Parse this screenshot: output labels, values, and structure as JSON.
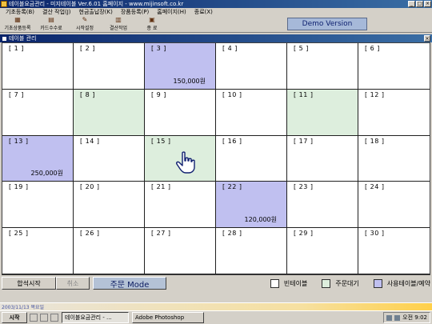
{
  "window": {
    "title": "테이블요금관리 - 미지테이블 Ver.6.01 홈페이지 - www.mijinsoft.co.kr",
    "minimize": "_",
    "maximize": "□",
    "close": "×"
  },
  "menu": [
    "기초등록(B)",
    "결산 작업(J)",
    "현금출납장(K)",
    "장품등록(P)",
    "홈페이지(H)",
    "종료(X)"
  ],
  "toolbar": [
    {
      "label": "기초상품등록",
      "icon": "box-icon"
    },
    {
      "label": "카드수수료",
      "icon": "card-icon"
    },
    {
      "label": "시작설정",
      "icon": "tools-icon"
    },
    {
      "label": "결산작업",
      "icon": "calc-icon"
    },
    {
      "label": "종 료",
      "icon": "exit-icon"
    }
  ],
  "demo_label": "Demo Version",
  "inner_window": {
    "title": "테이블 관리",
    "close": "×"
  },
  "tables": [
    {
      "num": "[ 1 ]",
      "status": "empty",
      "amount": ""
    },
    {
      "num": "[ 2 ]",
      "status": "empty",
      "amount": ""
    },
    {
      "num": "[ 3 ]",
      "status": "use",
      "amount": "150,000원"
    },
    {
      "num": "[ 4 ]",
      "status": "empty",
      "amount": ""
    },
    {
      "num": "[ 5 ]",
      "status": "empty",
      "amount": ""
    },
    {
      "num": "[ 6 ]",
      "status": "empty",
      "amount": ""
    },
    {
      "num": "[ 7 ]",
      "status": "empty",
      "amount": ""
    },
    {
      "num": "[ 8 ]",
      "status": "order",
      "amount": ""
    },
    {
      "num": "[ 9 ]",
      "status": "empty",
      "amount": ""
    },
    {
      "num": "[ 10 ]",
      "status": "empty",
      "amount": ""
    },
    {
      "num": "[ 11 ]",
      "status": "order",
      "amount": ""
    },
    {
      "num": "[ 12 ]",
      "status": "empty",
      "amount": ""
    },
    {
      "num": "[ 13 ]",
      "status": "use",
      "amount": "250,000원"
    },
    {
      "num": "[ 14 ]",
      "status": "empty",
      "amount": ""
    },
    {
      "num": "[ 15 ]",
      "status": "order",
      "amount": ""
    },
    {
      "num": "[ 16 ]",
      "status": "empty",
      "amount": ""
    },
    {
      "num": "[ 17 ]",
      "status": "empty",
      "amount": ""
    },
    {
      "num": "[ 18 ]",
      "status": "empty",
      "amount": ""
    },
    {
      "num": "[ 19 ]",
      "status": "empty",
      "amount": ""
    },
    {
      "num": "[ 20 ]",
      "status": "empty",
      "amount": ""
    },
    {
      "num": "[ 21 ]",
      "status": "empty",
      "amount": ""
    },
    {
      "num": "[ 22 ]",
      "status": "use",
      "amount": "120,000원"
    },
    {
      "num": "[ 23 ]",
      "status": "empty",
      "amount": ""
    },
    {
      "num": "[ 24 ]",
      "status": "empty",
      "amount": ""
    },
    {
      "num": "[ 25 ]",
      "status": "empty",
      "amount": ""
    },
    {
      "num": "[ 26 ]",
      "status": "empty",
      "amount": ""
    },
    {
      "num": "[ 27 ]",
      "status": "empty",
      "amount": ""
    },
    {
      "num": "[ 28 ]",
      "status": "empty",
      "amount": ""
    },
    {
      "num": "[ 29 ]",
      "status": "empty",
      "amount": ""
    },
    {
      "num": "[ 30 ]",
      "status": "empty",
      "amount": ""
    }
  ],
  "controls": {
    "start": "합석시작",
    "cancel": "취소",
    "mode": "주문 Mode"
  },
  "legend": [
    {
      "label": "빈테이블",
      "color": "#ffffff"
    },
    {
      "label": "주문대기",
      "color": "#ddeedd"
    },
    {
      "label": "사용테이블/예약",
      "color": "#c0c0f0"
    }
  ],
  "status_text": "2003/11/13 목요일",
  "taskbar": {
    "start": "시작",
    "tasks": [
      "테이블요금관리 - ...",
      "Adobe Photoshop"
    ],
    "clock": "오전 9:02"
  },
  "colors": {
    "order": "#ddeedd",
    "use": "#c0c0f0",
    "empty": "#ffffff",
    "titlebar": "#0a246a"
  }
}
